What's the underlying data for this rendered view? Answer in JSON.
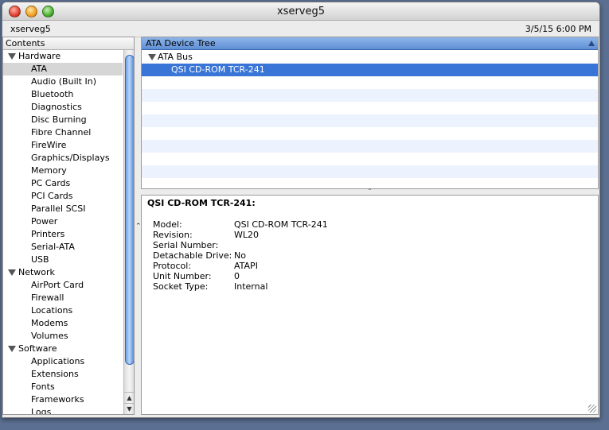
{
  "window": {
    "title": "xserveg5",
    "machine_name": "xserveg5",
    "datetime": "3/5/15 6:00 PM"
  },
  "sidebar": {
    "header": "Contents",
    "selected": "ATA",
    "sections": [
      {
        "label": "Hardware",
        "items": [
          "ATA",
          "Audio (Built In)",
          "Bluetooth",
          "Diagnostics",
          "Disc Burning",
          "Fibre Channel",
          "FireWire",
          "Graphics/Displays",
          "Memory",
          "PC Cards",
          "PCI Cards",
          "Parallel SCSI",
          "Power",
          "Printers",
          "Serial-ATA",
          "USB"
        ]
      },
      {
        "label": "Network",
        "items": [
          "AirPort Card",
          "Firewall",
          "Locations",
          "Modems",
          "Volumes"
        ]
      },
      {
        "label": "Software",
        "items": [
          "Applications",
          "Extensions",
          "Fonts",
          "Frameworks",
          "Logs"
        ]
      }
    ]
  },
  "device_tree": {
    "header": "ATA Device Tree",
    "bus_label": "ATA Bus",
    "device_label": "QSI CD-ROM TCR-241"
  },
  "detail": {
    "title": "QSI CD-ROM TCR-241:",
    "fields": [
      {
        "key": "Model:",
        "value": "QSI CD-ROM TCR-241"
      },
      {
        "key": "Revision:",
        "value": "WL20"
      },
      {
        "key": "Serial Number:",
        "value": ""
      },
      {
        "key": "Detachable Drive:",
        "value": "No"
      },
      {
        "key": "Protocol:",
        "value": "ATAPI"
      },
      {
        "key": "Unit Number:",
        "value": "0"
      },
      {
        "key": "Socket Type:",
        "value": "Internal"
      }
    ]
  },
  "icons": {
    "close": "close-button-icon",
    "minimize": "minimize-button-icon",
    "zoom": "zoom-button-icon",
    "disclosure": "disclosure-triangle-icon"
  },
  "colors": {
    "selection": "#3875d7",
    "header_blue": "#6f9be0",
    "alt_row": "#edf3fe"
  }
}
